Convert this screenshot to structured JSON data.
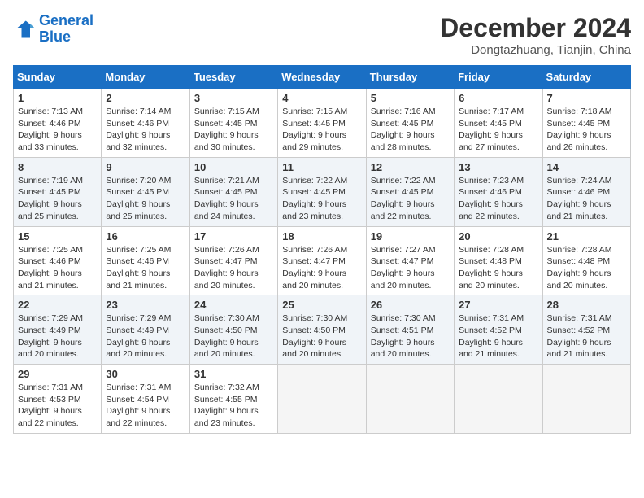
{
  "logo": {
    "line1": "General",
    "line2": "Blue"
  },
  "title": "December 2024",
  "location": "Dongtazhuang, Tianjin, China",
  "days_of_week": [
    "Sunday",
    "Monday",
    "Tuesday",
    "Wednesday",
    "Thursday",
    "Friday",
    "Saturday"
  ],
  "weeks": [
    [
      {
        "day": "1",
        "sunrise": "7:13 AM",
        "sunset": "4:46 PM",
        "daylight": "9 hours and 33 minutes."
      },
      {
        "day": "2",
        "sunrise": "7:14 AM",
        "sunset": "4:46 PM",
        "daylight": "9 hours and 32 minutes."
      },
      {
        "day": "3",
        "sunrise": "7:15 AM",
        "sunset": "4:45 PM",
        "daylight": "9 hours and 30 minutes."
      },
      {
        "day": "4",
        "sunrise": "7:15 AM",
        "sunset": "4:45 PM",
        "daylight": "9 hours and 29 minutes."
      },
      {
        "day": "5",
        "sunrise": "7:16 AM",
        "sunset": "4:45 PM",
        "daylight": "9 hours and 28 minutes."
      },
      {
        "day": "6",
        "sunrise": "7:17 AM",
        "sunset": "4:45 PM",
        "daylight": "9 hours and 27 minutes."
      },
      {
        "day": "7",
        "sunrise": "7:18 AM",
        "sunset": "4:45 PM",
        "daylight": "9 hours and 26 minutes."
      }
    ],
    [
      {
        "day": "8",
        "sunrise": "7:19 AM",
        "sunset": "4:45 PM",
        "daylight": "9 hours and 25 minutes."
      },
      {
        "day": "9",
        "sunrise": "7:20 AM",
        "sunset": "4:45 PM",
        "daylight": "9 hours and 25 minutes."
      },
      {
        "day": "10",
        "sunrise": "7:21 AM",
        "sunset": "4:45 PM",
        "daylight": "9 hours and 24 minutes."
      },
      {
        "day": "11",
        "sunrise": "7:22 AM",
        "sunset": "4:45 PM",
        "daylight": "9 hours and 23 minutes."
      },
      {
        "day": "12",
        "sunrise": "7:22 AM",
        "sunset": "4:45 PM",
        "daylight": "9 hours and 22 minutes."
      },
      {
        "day": "13",
        "sunrise": "7:23 AM",
        "sunset": "4:46 PM",
        "daylight": "9 hours and 22 minutes."
      },
      {
        "day": "14",
        "sunrise": "7:24 AM",
        "sunset": "4:46 PM",
        "daylight": "9 hours and 21 minutes."
      }
    ],
    [
      {
        "day": "15",
        "sunrise": "7:25 AM",
        "sunset": "4:46 PM",
        "daylight": "9 hours and 21 minutes."
      },
      {
        "day": "16",
        "sunrise": "7:25 AM",
        "sunset": "4:46 PM",
        "daylight": "9 hours and 21 minutes."
      },
      {
        "day": "17",
        "sunrise": "7:26 AM",
        "sunset": "4:47 PM",
        "daylight": "9 hours and 20 minutes."
      },
      {
        "day": "18",
        "sunrise": "7:26 AM",
        "sunset": "4:47 PM",
        "daylight": "9 hours and 20 minutes."
      },
      {
        "day": "19",
        "sunrise": "7:27 AM",
        "sunset": "4:47 PM",
        "daylight": "9 hours and 20 minutes."
      },
      {
        "day": "20",
        "sunrise": "7:28 AM",
        "sunset": "4:48 PM",
        "daylight": "9 hours and 20 minutes."
      },
      {
        "day": "21",
        "sunrise": "7:28 AM",
        "sunset": "4:48 PM",
        "daylight": "9 hours and 20 minutes."
      }
    ],
    [
      {
        "day": "22",
        "sunrise": "7:29 AM",
        "sunset": "4:49 PM",
        "daylight": "9 hours and 20 minutes."
      },
      {
        "day": "23",
        "sunrise": "7:29 AM",
        "sunset": "4:49 PM",
        "daylight": "9 hours and 20 minutes."
      },
      {
        "day": "24",
        "sunrise": "7:30 AM",
        "sunset": "4:50 PM",
        "daylight": "9 hours and 20 minutes."
      },
      {
        "day": "25",
        "sunrise": "7:30 AM",
        "sunset": "4:50 PM",
        "daylight": "9 hours and 20 minutes."
      },
      {
        "day": "26",
        "sunrise": "7:30 AM",
        "sunset": "4:51 PM",
        "daylight": "9 hours and 20 minutes."
      },
      {
        "day": "27",
        "sunrise": "7:31 AM",
        "sunset": "4:52 PM",
        "daylight": "9 hours and 21 minutes."
      },
      {
        "day": "28",
        "sunrise": "7:31 AM",
        "sunset": "4:52 PM",
        "daylight": "9 hours and 21 minutes."
      }
    ],
    [
      {
        "day": "29",
        "sunrise": "7:31 AM",
        "sunset": "4:53 PM",
        "daylight": "9 hours and 22 minutes."
      },
      {
        "day": "30",
        "sunrise": "7:31 AM",
        "sunset": "4:54 PM",
        "daylight": "9 hours and 22 minutes."
      },
      {
        "day": "31",
        "sunrise": "7:32 AM",
        "sunset": "4:55 PM",
        "daylight": "9 hours and 23 minutes."
      },
      null,
      null,
      null,
      null
    ]
  ]
}
